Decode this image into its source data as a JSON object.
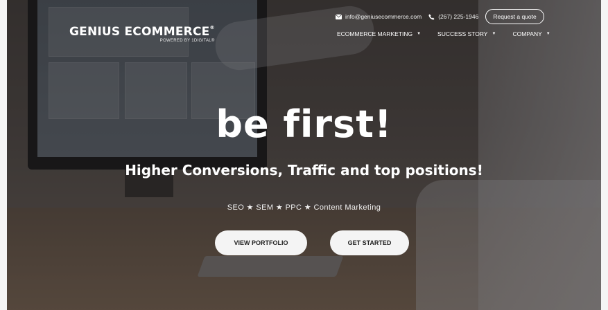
{
  "header": {
    "logo_title": "GENIUS ECOMMERCE",
    "logo_reg": "®",
    "logo_subtitle": "POWERED BY 1DIGITAL®",
    "email": "info@geniusecommerce.com",
    "phone": "(267) 225-1946",
    "quote_button": "Request a quote",
    "icons": {
      "email": "envelope-icon",
      "phone": "phone-icon",
      "dropdown": "caret-down-icon"
    }
  },
  "nav": {
    "items": [
      {
        "label": "ECOMMERCE MARKETING",
        "caret": "▼"
      },
      {
        "label": "SUCCESS STORY",
        "caret": "▼"
      },
      {
        "label": "COMPANY",
        "caret": "▼"
      }
    ]
  },
  "hero": {
    "headline": "be first!",
    "subheadline": "Higher Conversions, Traffic and top positions!",
    "services": "SEO ★ SEM ★ PPC ★ Content Marketing",
    "buttons": {
      "portfolio": "VIEW PORTFOLIO",
      "started": "GET STARTED"
    }
  },
  "colors": {
    "overlay": "#1a1616",
    "button_bg": "#f4f4f4",
    "button_text": "#222222",
    "text": "#ffffff"
  }
}
